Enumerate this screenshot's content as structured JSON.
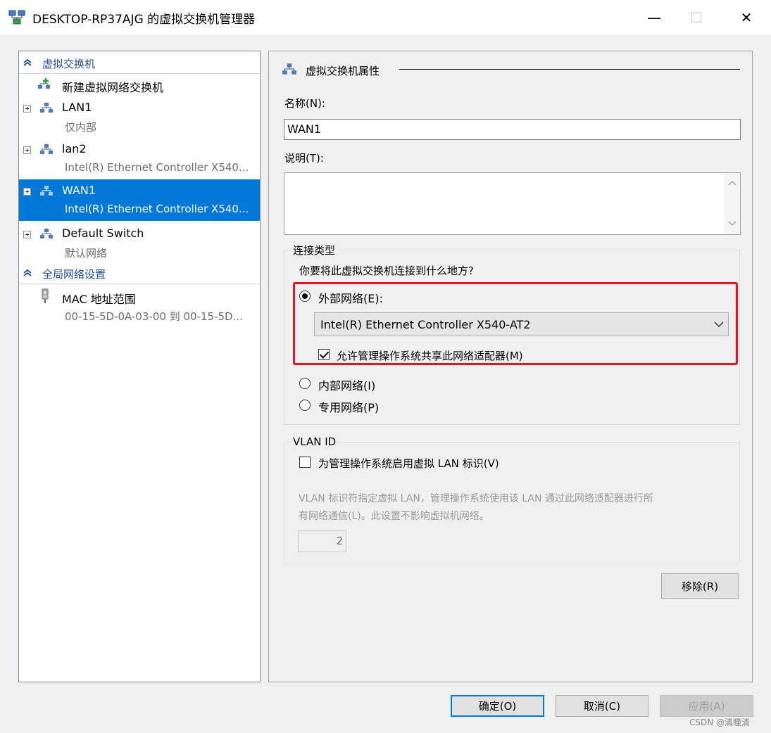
{
  "window": {
    "title": "DESKTOP-RP37AJG 的虚拟交换机管理器",
    "controls": {
      "minimize": "—",
      "maximize": "☐",
      "close": "✕"
    }
  },
  "left_pane": {
    "section_switches": "虚拟交换机",
    "new_switch": "新建虚拟网络交换机",
    "switches": [
      {
        "name": "LAN1",
        "detail": "仅内部"
      },
      {
        "name": "lan2",
        "detail": "Intel(R) Ethernet Controller X540..."
      },
      {
        "name": "WAN1",
        "detail": "Intel(R) Ethernet Controller X540..."
      },
      {
        "name": "Default Switch",
        "detail": "默认网络"
      }
    ],
    "section_global": "全局网络设置",
    "mac_range": {
      "name": "MAC 地址范围",
      "detail": "00-15-5D-0A-03-00 到 00-15-5D..."
    }
  },
  "right_pane": {
    "header": "虚拟交换机属性",
    "name_label": "名称(N):",
    "name_value": "WAN1",
    "notes_label": "说明(T):",
    "notes_value": "",
    "connection_type": {
      "title": "连接类型",
      "question": "你要将此虚拟交换机连接到什么地方?",
      "external_label": "外部网络(E):",
      "adapter_selected": "Intel(R) Ethernet Controller X540-AT2",
      "allow_sharing_label": "允许管理操作系统共享此网络适配器(M)",
      "internal_label": "内部网络(I)",
      "private_label": "专用网络(P)"
    },
    "vlan": {
      "title": "VLAN ID",
      "enable_label": "为管理操作系统启用虚拟 LAN 标识(V)",
      "description_line1": "VLAN 标识符指定虚拟 LAN，管理操作系统使用该 LAN 通过此网络适配器进行所",
      "description_line2": "有网络通信(L)。此设置不影响虚拟机网络。",
      "value": "2"
    },
    "remove_button": "移除(R)"
  },
  "footer": {
    "ok": "确定(O)",
    "cancel": "取消(C)",
    "apply": "应用(A)"
  },
  "watermark": "CSDN @清瞳清",
  "colors": {
    "selection": "#0078d7",
    "highlight_box": "#e81123",
    "section_header_text": "#1f4e9c"
  }
}
